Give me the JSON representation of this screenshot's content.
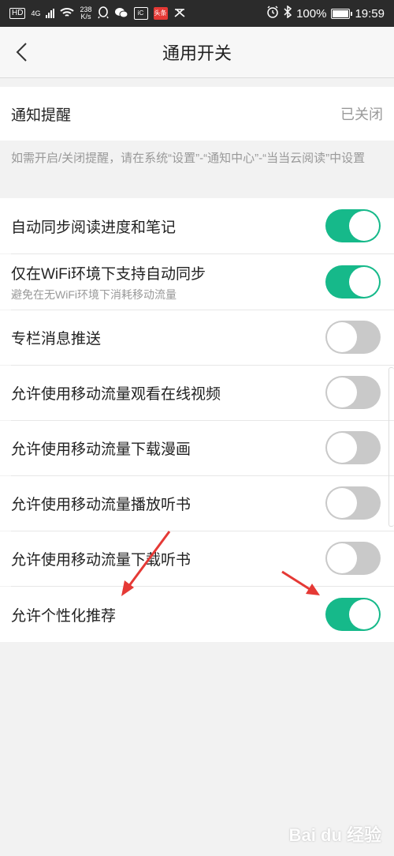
{
  "statusbar": {
    "hd": "HD",
    "net": "4G",
    "speed_top": "238",
    "speed_bottom": "K/s",
    "news_badge": "头条",
    "battery": "100%",
    "time": "19:59"
  },
  "header": {
    "title": "通用开关"
  },
  "notify": {
    "label": "通知提醒",
    "value": "已关闭",
    "note": "如需开启/关闭提醒，请在系统“设置”-“通知中心”-“当当云阅读”中设置"
  },
  "toggles": [
    {
      "label": "自动同步阅读进度和笔记",
      "sub": "",
      "on": true
    },
    {
      "label": "仅在WiFi环境下支持自动同步",
      "sub": "避免在无WiFi环境下消耗移动流量",
      "on": true
    },
    {
      "label": "专栏消息推送",
      "sub": "",
      "on": false
    },
    {
      "label": "允许使用移动流量观看在线视频",
      "sub": "",
      "on": false
    },
    {
      "label": "允许使用移动流量下载漫画",
      "sub": "",
      "on": false
    },
    {
      "label": "允许使用移动流量播放听书",
      "sub": "",
      "on": false
    },
    {
      "label": "允许使用移动流量下载听书",
      "sub": "",
      "on": false
    },
    {
      "label": "允许个性化推荐",
      "sub": "",
      "on": true
    }
  ],
  "colors": {
    "toggle_on": "#16b98a",
    "toggle_off": "#c9c9c9",
    "arrow": "#e53935"
  },
  "watermark": "Bai du 经验"
}
